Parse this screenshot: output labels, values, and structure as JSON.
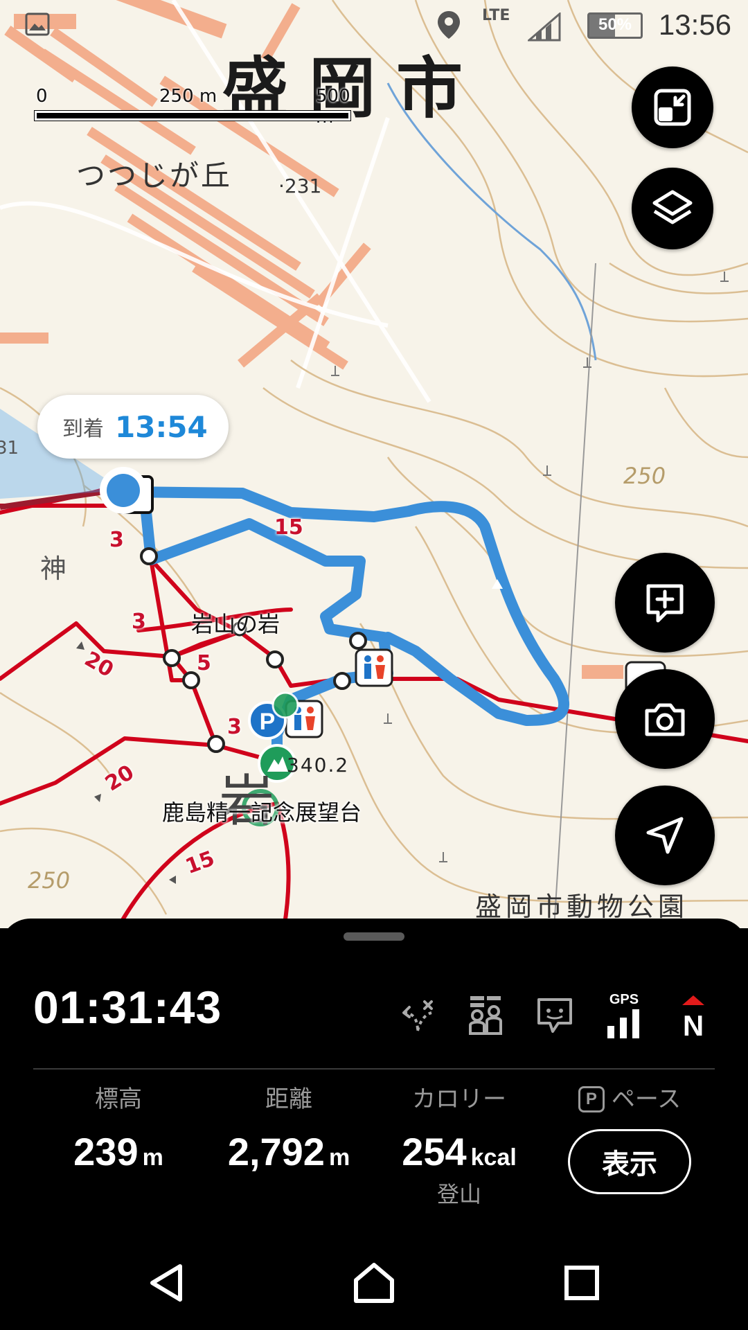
{
  "status_bar": {
    "network": "LTE",
    "battery": "50%",
    "time": "13:56"
  },
  "map": {
    "city_name": "盛岡市",
    "district": "つつじが丘",
    "spot_height_231": "231",
    "rock_name": "岩山の岩",
    "peak_elevation": "340.2",
    "observatory": "鹿島精一記念展望台",
    "zoo": "盛岡市動物公園",
    "iwa": "岩",
    "kami": "神",
    "contour_labels": [
      "250",
      "250",
      "31"
    ],
    "scale": {
      "ticks": [
        "0",
        "250 m",
        "500 m"
      ]
    },
    "trail_numbers": [
      "15",
      "3",
      "3",
      "5",
      "3",
      "20",
      "20",
      "15"
    ],
    "arrival": {
      "label": "到着",
      "time": "13:54"
    },
    "colors": {
      "route": "#3b8fd9",
      "trail": "#d0021b",
      "contour": "#d8b98a"
    }
  },
  "map_buttons": [
    "collapse-map-icon",
    "layers-icon",
    "add-memo-icon",
    "camera-icon",
    "navigate-icon"
  ],
  "panel": {
    "elapsed_time": "01:31:43",
    "status_icons": [
      "off-route-icon",
      "group-icon",
      "chat-icon",
      "gps-signal-icon",
      "north-up-icon"
    ],
    "gps_label": "GPS",
    "north_label": "N",
    "stats": [
      {
        "label": "標高",
        "value": "239",
        "unit": "m"
      },
      {
        "label": "距離",
        "value": "2,792",
        "unit": "m"
      },
      {
        "label": "カロリー",
        "value": "254",
        "unit": "kcal",
        "sub": "登山"
      }
    ],
    "pace": {
      "badge": "P",
      "label": "ペース",
      "button": "表示"
    }
  },
  "navbar": [
    "back-icon",
    "home-icon",
    "recents-icon"
  ]
}
